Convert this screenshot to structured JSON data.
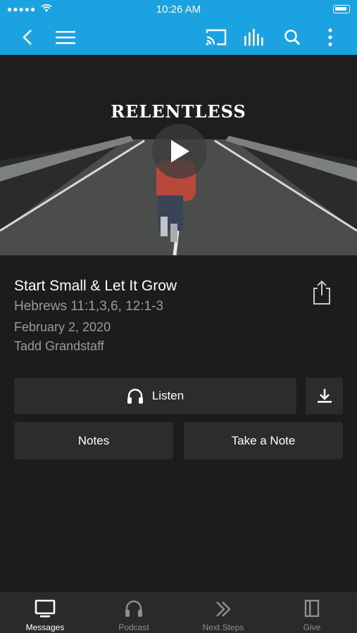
{
  "status_bar": {
    "time": "10:26 AM",
    "signal": "●●●●●"
  },
  "header": {
    "back_icon": "chevron-left-icon",
    "menu_icon": "hamburger-menu-icon",
    "cast_icon": "cast-icon",
    "audio_icon": "equalizer-icon",
    "search_icon": "search-icon",
    "more_icon": "more-vertical-icon",
    "accent_color": "#1aa3e0"
  },
  "hero": {
    "series_title": "RELENTLESS"
  },
  "message": {
    "title": "Start Small & Let It Grow",
    "scripture": "Hebrews 11:1,3,6, 12:1-3",
    "date": "February 2, 2020",
    "speaker": "Tadd Grandstaff"
  },
  "actions": {
    "listen": "Listen",
    "notes": "Notes",
    "take_note": "Take a Note"
  },
  "tabs": [
    {
      "label": "Messages",
      "icon": "tv-icon",
      "active": true
    },
    {
      "label": "Podcast",
      "icon": "headphones-icon",
      "active": false
    },
    {
      "label": "Next Steps",
      "icon": "double-chevron-icon",
      "active": false
    },
    {
      "label": "Give",
      "icon": "book-icon",
      "active": false
    }
  ]
}
